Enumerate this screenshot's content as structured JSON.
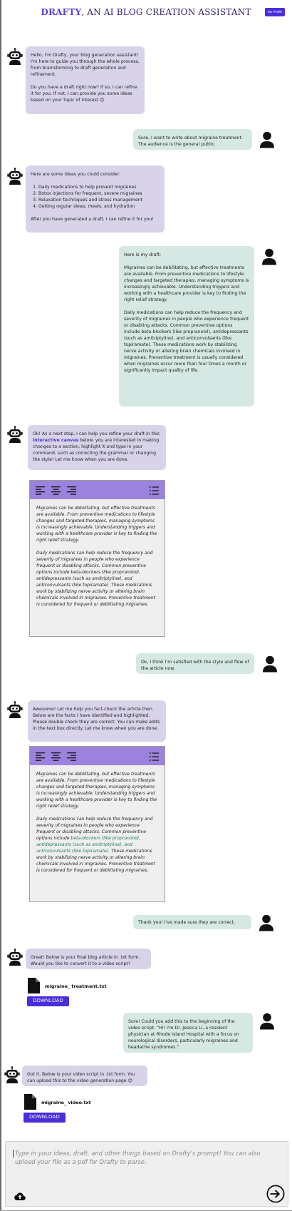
{
  "header": {
    "brand": "DRAFTY",
    "subtitle": ", AN AI BLOG CREATION ASSISTANT",
    "profile_button": "My Profile"
  },
  "messages": {
    "m1": {
      "role": "bot",
      "p1": "Hello, I'm Drafty, your blog generation assistant! I'm here to guide you through the whole process, from brainstorming to draft generation and refinement.",
      "p2": "Do you have a draft right now? If so, I can refine it for you. If not, I can provide you some ideas based on your topic of interest 😊"
    },
    "m2": {
      "role": "user",
      "text": "Sure, I want to write about migraine treatment. The audience is the general public."
    },
    "m3": {
      "role": "bot",
      "intro": "Here are some ideas you could consider:",
      "ideas": [
        "Daily medications to help prevent migraines",
        "Botox injections for frequent, severe migraines",
        "Relaxation techniques and stress management",
        "Getting regular sleep, meals, and hydration"
      ],
      "outro": "After you have generated a draft, I can refine it for you!"
    },
    "m4": {
      "role": "user",
      "p1": "Here is my draft:",
      "p2": "Migraines can be debilitating, but effective treatments are available. From preventive medications to lifestyle changes and targeted therapies, managing symptoms is increasingly achievable. Understanding triggers and working with a healthcare provider is key to finding the right relief strategy.",
      "p3": "Daily medications can help reduce the frequency and severity of migraines in people who experience frequent or disabling attacks. Common preventive options include beta-blockers (like propranolol), antidepressants (such as amitriptyline), and anticonvulsants (like topiramate). These medications work by stabilizing nerve activity or altering brain chemicals involved in migraines. Preventive treatment is usually considered when migraines occur more than four times a month or significantly impact quality of life."
    },
    "m5": {
      "role": "bot",
      "t1": "Ok! As a next step, I can help you refine your draft in this ",
      "link": "interactive canvas",
      "t2": " below. you are interested in making changes to a section, highlight it and type in your command, such as correcting the grammar or changing the style! Let me know when you are done."
    },
    "m6": {
      "role": "user",
      "text": "Ok, I think I'm satisfied with the style and flow of the article now."
    },
    "m7": {
      "role": "bot",
      "text": "Awesome! Let me help you fact-check the article then. Below are the facts I have identified and highlighted. Please double check they are correct. You can make edits in the text box directly. Let me know when you are done."
    },
    "m8": {
      "role": "user",
      "text": "Thank you! I've made sure they are correct."
    },
    "m9": {
      "role": "bot",
      "text": "Great! Below is your final blog article in .txt form. Would you like to convert it to a video script?"
    },
    "m10": {
      "role": "user",
      "text": "Sure! Could you add this to the beginning of the video script: “Hi! I'm Dr. Jessica Li, a resident physician at Rhode Island Hospital with a focus on neurological disorders, particularly migraines and headache syndromes.”"
    },
    "m11": {
      "role": "bot",
      "text": "Got it. Below is your video script in .txt form. You can upload this to the video generation page 😊"
    }
  },
  "canvas1": {
    "p1": "Migraines can be debilitating, but effective treatments are available. From preventive medications to lifestyle changes and targeted therapies, managing symptoms is increasingly achievable. Understanding triggers and working with a healthcare provider is key to finding the right relief strategy.",
    "p2": "Daily medications can help reduce the frequency and severity of migraines in people who experience frequent or disabling attacks. Common preventive options include beta-blockers (like propranolol), antidepressants (such as amitriptyline), and anticonvulsants (like topiramate). These medications work by stabilizing nerve activity or altering brain chemicals involved in migraines. Preventive treatment is considered for frequent or debilitating migraines."
  },
  "canvas2": {
    "p1": "Migraines can be debilitating, but effective treatments are available. From preventive medications to lifestyle changes and targeted therapies, managing symptoms is increasingly achievable. Understanding triggers and working with a healthcare provider is key to finding the right relief strategy.",
    "p2a": "Daily medications can help reduce the frequency and severity of migraines in people who experience frequent or disabling attacks. Common preventive options include ",
    "p2_fact": "beta-blockers (like propranolol), antidepressants (such as amitriptyline), and anticonvulsants (like topiramate)",
    "p2b": ". These medications work by stabilizing nerve activity or altering brain chemicals involved in migraines. Preventive treatment is considered for frequent or debilitating migraines."
  },
  "files": {
    "article": {
      "name": "migraine_ treatment.txt",
      "button": "DOWNLOAD"
    },
    "script": {
      "name": "migraine_ video.txt",
      "button": "DOWNLOAD"
    }
  },
  "composer": {
    "placeholder": "Type in your ideas, draft, and other things based on Drafty's prompt! You can also upload your file as a pdf for Drafty to parse."
  },
  "icons": {
    "bot_avatar": "robot-icon",
    "user_avatar": "person-icon",
    "toolbar": [
      "align-left-icon",
      "align-center-icon",
      "align-right-icon",
      "bulleted-list-icon"
    ],
    "file": "file-icon",
    "upload": "cloud-upload-icon",
    "send": "send-icon"
  },
  "colors": {
    "brand": "#5b3fd6",
    "title_text": "#2a2470",
    "button": "#4a2ed8",
    "bot_bubble": "#d9d3ea",
    "user_bubble": "#d6e8e3",
    "canvas_toolbar": "#9b82dc",
    "canvas_bg": "#efefef",
    "fact_highlight": "#1f7a4f"
  }
}
